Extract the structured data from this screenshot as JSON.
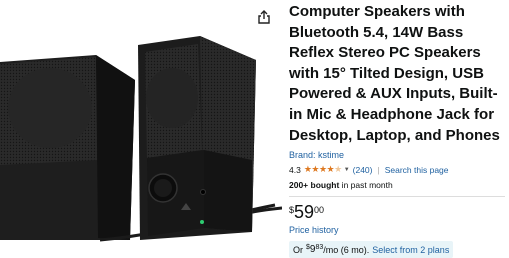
{
  "product": {
    "title": "Computer Speakers with Bluetooth 5.4, 14W Bass Reflex Stereo PC Speakers with 15° Tilted Design, USB Powered & AUX Inputs, Built-in Mic & Headphone Jack for Desktop, Laptop, and Phones",
    "brand_label": "Brand: kstime",
    "rating": "4.3",
    "star_count": 4.3,
    "reviews": "(240)",
    "search_link": "Search this page",
    "bought": "200+ bought",
    "bought_suffix": " in past month"
  },
  "price": {
    "symbol": "$",
    "whole": "59",
    "fraction": "00",
    "history_link": "Price history"
  },
  "monthly": {
    "or_label": "Or",
    "symbol": "$",
    "whole": "9",
    "fraction": "83",
    "term": "/mo (6 mo).",
    "select_link": "Select from 2 plans"
  },
  "colors": {
    "link": "#2162a1",
    "star": "#de7921",
    "monthly_bg": "#e8f4f8"
  },
  "icons": {
    "share": "share-icon"
  }
}
